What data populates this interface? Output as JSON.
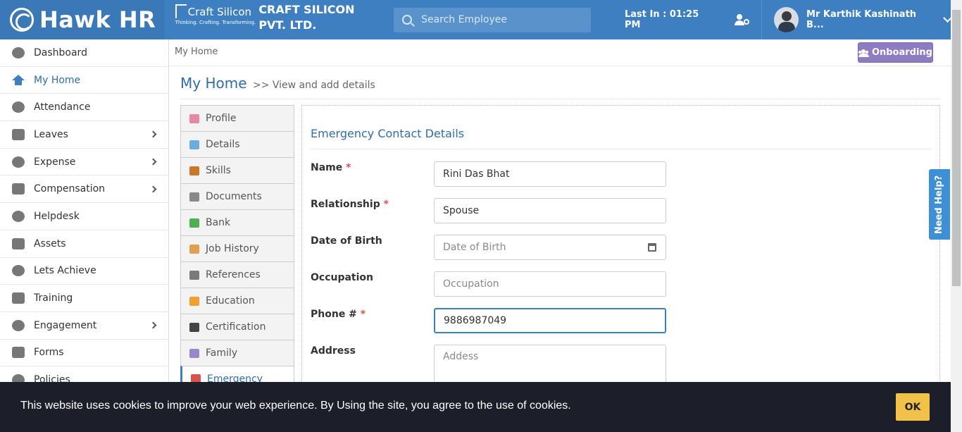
{
  "brand": {
    "name": "Hawk HR"
  },
  "company": {
    "logo_name": "Craft Silicon",
    "logo_tagline": "Thinking. Crafting. Transforming.",
    "name": "CRAFT SILICON PVT. LTD."
  },
  "header": {
    "search_placeholder": "Search Employee",
    "last_in_label": "Last In : ",
    "last_in_time": "01:25 PM",
    "username": "Mr Karthik Kashinath B..."
  },
  "sidebar": {
    "items": [
      {
        "label": "Dashboard",
        "icon": "dashboard-icon",
        "has_submenu": false
      },
      {
        "label": "My Home",
        "icon": "home-icon",
        "has_submenu": false,
        "active": true
      },
      {
        "label": "Attendance",
        "icon": "clock-icon",
        "has_submenu": false
      },
      {
        "label": "Leaves",
        "icon": "user-leave-icon",
        "has_submenu": true
      },
      {
        "label": "Expense",
        "icon": "credit-card-icon",
        "has_submenu": true
      },
      {
        "label": "Compensation",
        "icon": "money-icon",
        "has_submenu": true
      },
      {
        "label": "Helpdesk",
        "icon": "chat-icon",
        "has_submenu": false
      },
      {
        "label": "Assets",
        "icon": "cubes-icon",
        "has_submenu": false
      },
      {
        "label": "Lets Achieve",
        "icon": "hourglass-icon",
        "has_submenu": false
      },
      {
        "label": "Training",
        "icon": "training-icon",
        "has_submenu": false
      },
      {
        "label": "Engagement",
        "icon": "puzzle-icon",
        "has_submenu": true
      },
      {
        "label": "Forms",
        "icon": "edit-icon",
        "has_submenu": false
      },
      {
        "label": "Policies",
        "icon": "book-icon",
        "has_submenu": false
      }
    ]
  },
  "breadcrumb": {
    "current": "My Home"
  },
  "onboarding_button": {
    "label": "Onboarding"
  },
  "page": {
    "title": "My Home",
    "subtitle": ">> View and add details"
  },
  "tabs": [
    {
      "label": "Profile",
      "icon": "profile-icon",
      "color": "#e58aa5"
    },
    {
      "label": "Details",
      "icon": "user-icon",
      "color": "#6aaee0"
    },
    {
      "label": "Skills",
      "icon": "gear-icon",
      "color": "#c8782a"
    },
    {
      "label": "Documents",
      "icon": "folder-icon",
      "color": "#8a8a8a"
    },
    {
      "label": "Bank",
      "icon": "bank-icon",
      "color": "#4caf50"
    },
    {
      "label": "Job History",
      "icon": "history-icon",
      "color": "#e0a050"
    },
    {
      "label": "References",
      "icon": "share-icon",
      "color": "#7a7a7a"
    },
    {
      "label": "Education",
      "icon": "book-icon",
      "color": "#f0a030"
    },
    {
      "label": "Certification",
      "icon": "graduation-cap-icon",
      "color": "#444444"
    },
    {
      "label": "Family",
      "icon": "family-icon",
      "color": "#9b88cc"
    },
    {
      "label": "Emergency",
      "icon": "medkit-icon",
      "color": "#d9534f",
      "active": true
    }
  ],
  "form": {
    "title": "Emergency Contact Details",
    "fields": [
      {
        "label": "Name",
        "required": true,
        "value": "Rini Das Bhat",
        "placeholder": ""
      },
      {
        "label": "Relationship",
        "required": true,
        "value": "Spouse",
        "placeholder": ""
      },
      {
        "label": "Date of Birth",
        "required": false,
        "value": "",
        "placeholder": "Date of Birth"
      },
      {
        "label": "Occupation",
        "required": false,
        "value": "",
        "placeholder": "Occupation"
      },
      {
        "label": "Phone #",
        "required": true,
        "value": "9886987049",
        "placeholder": ""
      },
      {
        "label": "Address",
        "required": false,
        "value": "",
        "placeholder": "Addess"
      }
    ]
  },
  "help_tab": {
    "label": "Need Help?"
  },
  "cookie_banner": {
    "text": "This website uses cookies to improve your web experience. By Using the site, you agree to the use of cookies.",
    "ok_label": "OK"
  }
}
